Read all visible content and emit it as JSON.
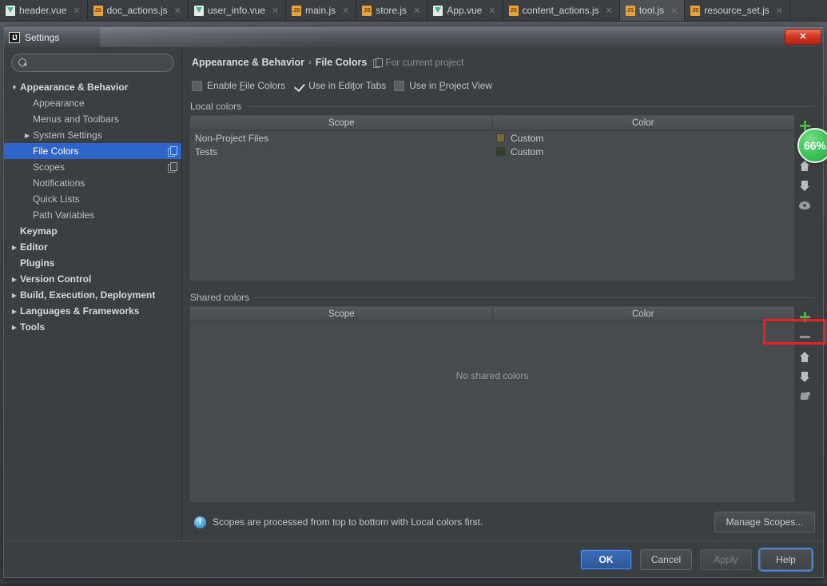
{
  "editor_tabs": [
    {
      "label": "header.vue",
      "type": "vue",
      "active": false
    },
    {
      "label": "doc_actions.js",
      "type": "js",
      "active": false
    },
    {
      "label": "user_info.vue",
      "type": "vue",
      "active": false
    },
    {
      "label": "main.js",
      "type": "js",
      "active": false
    },
    {
      "label": "store.js",
      "type": "js",
      "active": false
    },
    {
      "label": "App.vue",
      "type": "vue",
      "active": false
    },
    {
      "label": "content_actions.js",
      "type": "js",
      "active": false
    },
    {
      "label": "tool.js",
      "type": "js",
      "active": true
    },
    {
      "label": "resource_set.js",
      "type": "js",
      "active": false
    }
  ],
  "window": {
    "title": "Settings",
    "logo_text": "IJ",
    "close_label": "✕"
  },
  "search": {
    "value": "",
    "placeholder": ""
  },
  "sidebar": {
    "items": [
      {
        "label": "Appearance & Behavior",
        "indent": 0,
        "arrow": "▼",
        "bold": true,
        "selected": false,
        "copy": false
      },
      {
        "label": "Appearance",
        "indent": 1,
        "arrow": "",
        "bold": false,
        "selected": false,
        "copy": false
      },
      {
        "label": "Menus and Toolbars",
        "indent": 1,
        "arrow": "",
        "bold": false,
        "selected": false,
        "copy": false
      },
      {
        "label": "System Settings",
        "indent": 1,
        "arrow": "▶",
        "bold": false,
        "selected": false,
        "copy": false
      },
      {
        "label": "File Colors",
        "indent": 1,
        "arrow": "",
        "bold": false,
        "selected": true,
        "copy": true
      },
      {
        "label": "Scopes",
        "indent": 1,
        "arrow": "",
        "bold": false,
        "selected": false,
        "copy": true
      },
      {
        "label": "Notifications",
        "indent": 1,
        "arrow": "",
        "bold": false,
        "selected": false,
        "copy": false
      },
      {
        "label": "Quick Lists",
        "indent": 1,
        "arrow": "",
        "bold": false,
        "selected": false,
        "copy": false
      },
      {
        "label": "Path Variables",
        "indent": 1,
        "arrow": "",
        "bold": false,
        "selected": false,
        "copy": false
      },
      {
        "label": "Keymap",
        "indent": 0,
        "arrow": "",
        "bold": true,
        "selected": false,
        "copy": false
      },
      {
        "label": "Editor",
        "indent": 0,
        "arrow": "▶",
        "bold": true,
        "selected": false,
        "copy": false
      },
      {
        "label": "Plugins",
        "indent": 0,
        "arrow": "",
        "bold": true,
        "selected": false,
        "copy": false
      },
      {
        "label": "Version Control",
        "indent": 0,
        "arrow": "▶",
        "bold": true,
        "selected": false,
        "copy": false
      },
      {
        "label": "Build, Execution, Deployment",
        "indent": 0,
        "arrow": "▶",
        "bold": true,
        "selected": false,
        "copy": false
      },
      {
        "label": "Languages & Frameworks",
        "indent": 0,
        "arrow": "▶",
        "bold": true,
        "selected": false,
        "copy": false
      },
      {
        "label": "Tools",
        "indent": 0,
        "arrow": "▶",
        "bold": true,
        "selected": false,
        "copy": false
      }
    ]
  },
  "breadcrumb": {
    "root": "Appearance & Behavior",
    "separator": "›",
    "current": "File Colors",
    "note": "For current project"
  },
  "options": [
    {
      "label_pre": "Enable ",
      "mnemonic": "F",
      "label_post": "ile Colors",
      "checked": false
    },
    {
      "label_pre": "Use in Edi",
      "mnemonic": "t",
      "label_post": "or Tabs",
      "checked": true
    },
    {
      "label_pre": "Use in ",
      "mnemonic": "P",
      "label_post": "roject View",
      "checked": false
    }
  ],
  "local_colors": {
    "title": "Local colors",
    "columns": [
      "Scope",
      "Color"
    ],
    "rows": [
      {
        "scope": "Non-Project Files",
        "color_label": "Custom",
        "swatch": "#7a6a3a"
      },
      {
        "scope": "Tests",
        "color_label": "Custom",
        "swatch": "#2e4429"
      }
    ],
    "tools": [
      "add",
      "remove",
      "move-up",
      "move-down",
      "share"
    ]
  },
  "shared_colors": {
    "title": "Shared colors",
    "columns": [
      "Scope",
      "Color"
    ],
    "rows": [],
    "empty_message": "No shared colors",
    "tools": [
      "add",
      "remove",
      "move-up",
      "move-down",
      "unshare"
    ]
  },
  "notice": {
    "icon_glyph": "!",
    "text": "Scopes are processed from top to bottom with Local colors first.",
    "button": "Manage Scopes..."
  },
  "buttons": {
    "ok": "OK",
    "cancel": "Cancel",
    "apply": "Apply",
    "help": "Help"
  },
  "overlay": {
    "badge_text": "66%",
    "highlight_color": "#f01f1f"
  },
  "colors": {
    "accent": "#2f65ca",
    "add_green": "#4caf50",
    "close_red": "#d43a26",
    "badge_green": "#43c75e"
  }
}
